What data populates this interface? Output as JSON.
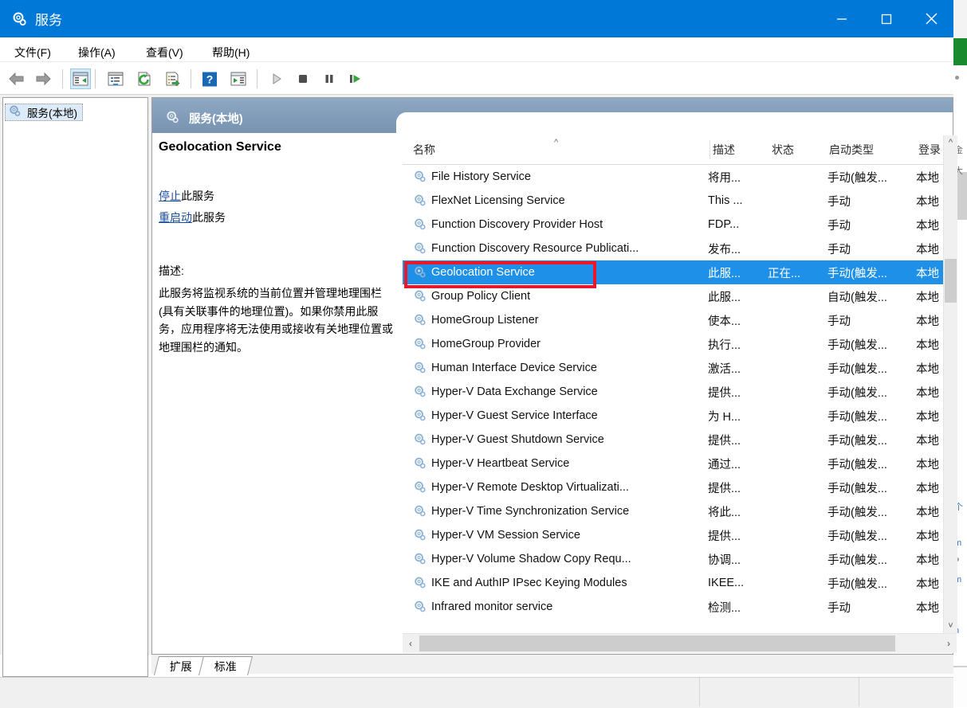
{
  "window": {
    "title": "服务",
    "title_icon": "gear-icon",
    "buttons": {
      "minimize": "最小化",
      "maximize": "最大化",
      "close": "关闭"
    }
  },
  "menubar": {
    "items": [
      {
        "label": "文件(F)",
        "name": "menu-file"
      },
      {
        "label": "操作(A)",
        "name": "menu-action"
      },
      {
        "label": "查看(V)",
        "name": "menu-view"
      },
      {
        "label": "帮助(H)",
        "name": "menu-help"
      }
    ]
  },
  "toolbar": {
    "items": [
      {
        "name": "back-icon",
        "label": "后退"
      },
      {
        "name": "forward-icon",
        "label": "前进"
      },
      {
        "name": "show-hide-console-tree-icon",
        "label": "显示/隐藏控制台树"
      },
      {
        "name": "properties-icon",
        "label": "属性"
      },
      {
        "name": "refresh-icon",
        "label": "刷新"
      },
      {
        "name": "export-list-icon",
        "label": "导出列表"
      },
      {
        "name": "help-icon",
        "label": "帮助"
      },
      {
        "name": "show-action-pane-icon",
        "label": "显示/隐藏操作窗格"
      },
      {
        "name": "start-service-icon",
        "label": "启动服务"
      },
      {
        "name": "stop-service-icon",
        "label": "停止服务"
      },
      {
        "name": "pause-service-icon",
        "label": "暂停服务"
      },
      {
        "name": "restart-service-icon",
        "label": "重启动服务"
      }
    ]
  },
  "tree": {
    "root": {
      "label": "服务(本地)",
      "icon": "gear-icon",
      "selected": true
    }
  },
  "pane": {
    "header_title": "服务(本地)",
    "header_icon": "gear-icon"
  },
  "details": {
    "service_name": "Geolocation Service",
    "links": [
      {
        "link": "停止",
        "suffix": "此服务",
        "name": "stop-service-link"
      },
      {
        "link": "重启动",
        "suffix": "此服务",
        "name": "restart-service-link"
      }
    ],
    "description_label": "描述:",
    "description_text": "此服务将监视系统的当前位置并管理地理围栏(具有关联事件的地理位置)。如果你禁用此服务，应用程序将无法使用或接收有关地理位置或地理围栏的通知。"
  },
  "list": {
    "columns": [
      {
        "label": "名称",
        "key": "name",
        "sorted": true,
        "sort_dir": "asc"
      },
      {
        "label": "描述",
        "key": "desc"
      },
      {
        "label": "状态",
        "key": "status"
      },
      {
        "label": "启动类型",
        "key": "startup"
      },
      {
        "label": "登录",
        "key": "logon"
      }
    ],
    "rows": [
      {
        "name": "File History Service",
        "desc": "将用...",
        "status": "",
        "startup": "手动(触发...",
        "logon": "本地",
        "selected": false
      },
      {
        "name": "FlexNet Licensing Service",
        "desc": "This ...",
        "status": "",
        "startup": "手动",
        "logon": "本地",
        "selected": false
      },
      {
        "name": "Function Discovery Provider Host",
        "desc": "FDP...",
        "status": "",
        "startup": "手动",
        "logon": "本地",
        "selected": false
      },
      {
        "name": "Function Discovery Resource Publicati...",
        "desc": "发布...",
        "status": "",
        "startup": "手动",
        "logon": "本地",
        "selected": false
      },
      {
        "name": "Geolocation Service",
        "desc": "此服...",
        "status": "正在...",
        "startup": "手动(触发...",
        "logon": "本地",
        "selected": true
      },
      {
        "name": "Group Policy Client",
        "desc": "此服...",
        "status": "",
        "startup": "自动(触发...",
        "logon": "本地",
        "selected": false
      },
      {
        "name": "HomeGroup Listener",
        "desc": "使本...",
        "status": "",
        "startup": "手动",
        "logon": "本地",
        "selected": false
      },
      {
        "name": "HomeGroup Provider",
        "desc": "执行...",
        "status": "",
        "startup": "手动(触发...",
        "logon": "本地",
        "selected": false
      },
      {
        "name": "Human Interface Device Service",
        "desc": "激活...",
        "status": "",
        "startup": "手动(触发...",
        "logon": "本地",
        "selected": false
      },
      {
        "name": "Hyper-V Data Exchange Service",
        "desc": "提供...",
        "status": "",
        "startup": "手动(触发...",
        "logon": "本地",
        "selected": false
      },
      {
        "name": "Hyper-V Guest Service Interface",
        "desc": "为 H...",
        "status": "",
        "startup": "手动(触发...",
        "logon": "本地",
        "selected": false
      },
      {
        "name": "Hyper-V Guest Shutdown Service",
        "desc": "提供...",
        "status": "",
        "startup": "手动(触发...",
        "logon": "本地",
        "selected": false
      },
      {
        "name": "Hyper-V Heartbeat Service",
        "desc": "通过...",
        "status": "",
        "startup": "手动(触发...",
        "logon": "本地",
        "selected": false
      },
      {
        "name": "Hyper-V Remote Desktop Virtualizati...",
        "desc": "提供...",
        "status": "",
        "startup": "手动(触发...",
        "logon": "本地",
        "selected": false
      },
      {
        "name": "Hyper-V Time Synchronization Service",
        "desc": "将此...",
        "status": "",
        "startup": "手动(触发...",
        "logon": "本地",
        "selected": false
      },
      {
        "name": "Hyper-V VM Session Service",
        "desc": "提供...",
        "status": "",
        "startup": "手动(触发...",
        "logon": "本地",
        "selected": false
      },
      {
        "name": "Hyper-V Volume Shadow Copy Requ...",
        "desc": "协调...",
        "status": "",
        "startup": "手动(触发...",
        "logon": "本地",
        "selected": false
      },
      {
        "name": "IKE and AuthIP IPsec Keying Modules",
        "desc": "IKEE...",
        "status": "",
        "startup": "手动(触发...",
        "logon": "本地",
        "selected": false
      },
      {
        "name": "Infrared monitor service",
        "desc": "检测...",
        "status": "",
        "startup": "手动",
        "logon": "本地",
        "selected": false
      }
    ]
  },
  "tabs": [
    {
      "label": "扩展",
      "name": "tab-extended",
      "active": true
    },
    {
      "label": "标准",
      "name": "tab-standard",
      "active": false
    }
  ],
  "annotation": {
    "highlight_target": "Geolocation Service",
    "color": "#e8182a"
  },
  "colors": {
    "titlebar": "#0078d7",
    "selection": "#1e90e8",
    "pane_header": "#7f9db9",
    "link": "#1a4fa0",
    "annotation": "#e8182a"
  }
}
